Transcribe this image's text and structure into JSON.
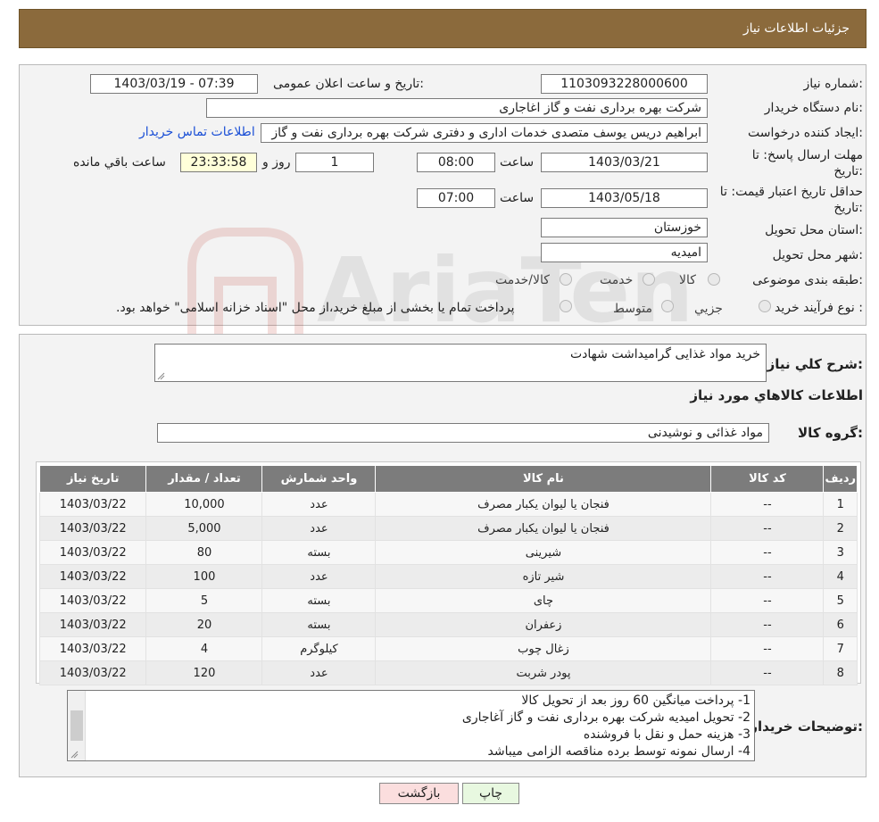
{
  "header": {
    "title": "جزئیات اطلاعات نیاز"
  },
  "form": {
    "need_number_label": "شماره نیاز:",
    "need_number": "1103093228000600",
    "announce_label": "تاریخ و ساعت اعلان عمومی:",
    "announce_value": "1403/03/19 - 07:39",
    "buyer_org_label": "نام دستگاه خریدار:",
    "buyer_org": "شرکت بهره برداری نفت و گاز اغاجاری",
    "creator_label": "ایجاد کننده درخواست:",
    "creator": "ابراهیم دریس یوسف متصدی خدمات اداری و دفتری شرکت بهره برداری نفت و گاز",
    "contact_link": "اطلاعات تماس خریدار",
    "deadline_label_line1": "مهلت ارسال پاسخ: تا",
    "deadline_label_line2": "تاریخ:",
    "deadline_date": "1403/03/21",
    "time_label": "ساعت",
    "deadline_time": "08:00",
    "days": "1",
    "days_label": "روز و",
    "remaining": "23:33:58",
    "remaining_label": "ساعت باقي مانده",
    "validity_label_line1": "حداقل تاریخ اعتبار قیمت: تا",
    "validity_label_line2": "تاریخ:",
    "validity_date": "1403/05/18",
    "validity_time": "07:00",
    "province_label": "استان محل تحویل:",
    "province": "خوزستان",
    "city_label": "شهر محل تحویل:",
    "city": "امیدیه",
    "category_label": "طبقه بندی موضوعی:",
    "category_options": [
      "کالا",
      "خدمت",
      "کالا/خدمت"
    ],
    "process_label": "نوع فرآیند خرید :",
    "process_options": [
      "جزيي",
      "متوسط"
    ],
    "process_note": "پرداخت تمام یا بخشی از مبلغ خرید،از محل \"اسناد خزانه اسلامی\" خواهد بود."
  },
  "description": {
    "label": "شرح کلي نياز:",
    "value": "خرید مواد غذایی گرامیداشت شهادت"
  },
  "goods": {
    "section_title": "اطلاعات کالاهاي مورد نياز",
    "group_label": "گروه کالا:",
    "group_value": "مواد غذائی و نوشیدنی",
    "columns": [
      "رديف",
      "کد کالا",
      "نام کالا",
      "واحد شمارش",
      "تعداد / مقدار",
      "تاریخ نیاز"
    ],
    "rows": [
      [
        "1",
        "--",
        "فنجان یا لیوان یکبار مصرف",
        "عدد",
        "10,000",
        "1403/03/22"
      ],
      [
        "2",
        "--",
        "فنجان یا لیوان یکبار مصرف",
        "عدد",
        "5,000",
        "1403/03/22"
      ],
      [
        "3",
        "--",
        "شیرینی",
        "بسته",
        "80",
        "1403/03/22"
      ],
      [
        "4",
        "--",
        "شیر تازه",
        "عدد",
        "100",
        "1403/03/22"
      ],
      [
        "5",
        "--",
        "چای",
        "بسته",
        "5",
        "1403/03/22"
      ],
      [
        "6",
        "--",
        "زعفران",
        "بسته",
        "20",
        "1403/03/22"
      ],
      [
        "7",
        "--",
        "زغال چوب",
        "کیلوگرم",
        "4",
        "1403/03/22"
      ],
      [
        "8",
        "--",
        "پودر شربت",
        "عدد",
        "120",
        "1403/03/22"
      ]
    ]
  },
  "notes": {
    "label": "توضیحات خریدار:",
    "lines": [
      "1- پرداخت میانگین 60 روز بعد از تحویل کالا",
      "2- تحویل امیدیه شرکت بهره برداری نفت و گاز آغاجاری",
      "3- هزینه حمل و نقل با فروشنده",
      "4- ارسال نمونه توسط برده مناقصه الزامی میباشد"
    ]
  },
  "buttons": {
    "print": "چاپ",
    "back": "بازگشت"
  },
  "watermark": {
    "text": "AriaTender.neT"
  },
  "colors": {
    "header": "#8b6a3c",
    "link": "#1a4fd6",
    "table_header": "#7c7c7c",
    "back_button": "#fbdede",
    "print_button": "#e8f8e0"
  }
}
